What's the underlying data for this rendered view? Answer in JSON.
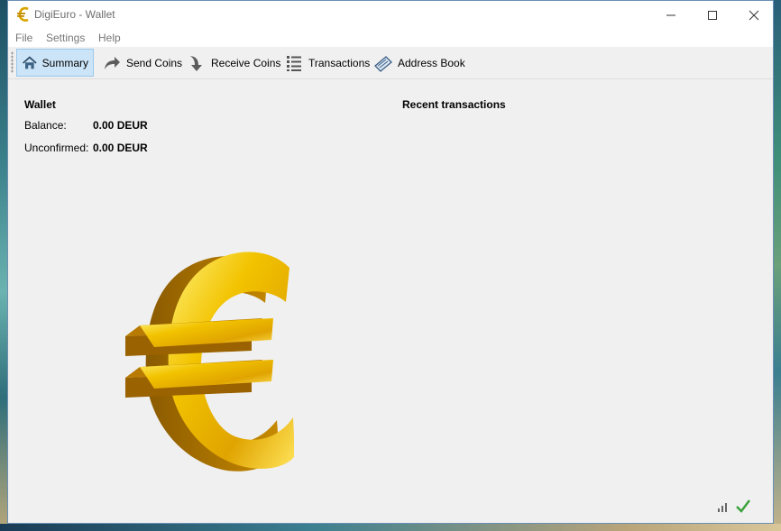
{
  "window": {
    "title": "DigiEuro - Wallet"
  },
  "menu": {
    "items": [
      "File",
      "Settings",
      "Help"
    ]
  },
  "toolbar": {
    "summary": "Summary",
    "send": "Send Coins",
    "receive": "Receive Coins",
    "transactions": "Transactions",
    "address_book": "Address Book"
  },
  "wallet": {
    "title": "Wallet",
    "balance_label": "Balance:",
    "balance_value": "0.00 DEUR",
    "unconfirmed_label": "Unconfirmed:",
    "unconfirmed_value": "0.00 DEUR"
  },
  "recent": {
    "title": "Recent transactions"
  },
  "status": {
    "icons": [
      "signal-bars-icon",
      "synced-checkmark-icon"
    ]
  },
  "colors": {
    "active_tab_bg": "#cce4f7",
    "active_tab_border": "#99c9ef",
    "check_green": "#3aa03a",
    "euro_gold": "#e8b400"
  }
}
